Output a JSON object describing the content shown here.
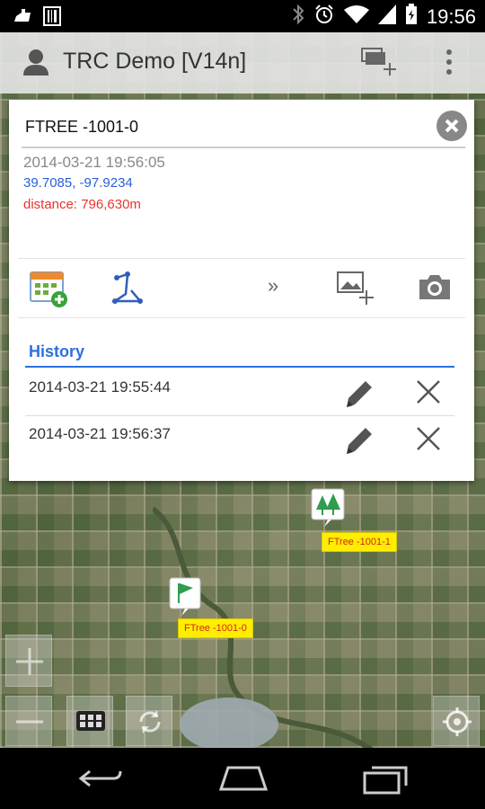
{
  "status_bar": {
    "time": "19:56"
  },
  "app_bar": {
    "title": "TRC Demo [V14n]"
  },
  "dialog": {
    "name": "FTREE -1001-0",
    "timestamp": "2014-03-21 19:56:05",
    "coordinates": "39.7085, -97.9234",
    "distance": "distance: 796,630m",
    "more_label": "»",
    "history": {
      "title": "History",
      "entries": [
        {
          "date": "2014-03-21 19:55:44"
        },
        {
          "date": "2014-03-21 19:56:37"
        }
      ]
    }
  },
  "markers": [
    {
      "label": "FTree -1001-1",
      "icon": "tree-icon"
    },
    {
      "label": "FTree -1001-0",
      "icon": "flag-icon"
    }
  ],
  "colors": {
    "accent": "#2e6fe0",
    "coords": "#2a5fd8",
    "distance": "#e8352e",
    "marker_label_bg": "#ffee00"
  }
}
